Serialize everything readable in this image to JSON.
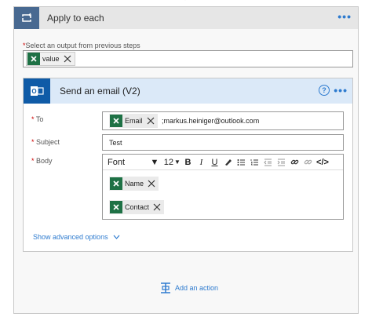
{
  "loop": {
    "title": "Apply to each",
    "more": "•••"
  },
  "select_output": {
    "label": "Select an output from previous steps",
    "required_mark": "*",
    "token": "value"
  },
  "action": {
    "title": "Send an email (V2)",
    "help": "?",
    "more": "•••",
    "to": {
      "label": "To",
      "token": "Email",
      "text": ";markus.heiniger@outlook.com"
    },
    "subject": {
      "label": "Subject",
      "value": "Test"
    },
    "body": {
      "label": "Body",
      "font": "Font",
      "font_size": "12",
      "tokens": [
        "Name",
        "Contact"
      ]
    },
    "advanced": "Show advanced options"
  },
  "add_action": "Add an action",
  "colors": {
    "accent": "#2e7bcf",
    "loop": "#486991",
    "outlook": "#0f5ba7",
    "excel": "#1e7145",
    "header_bg": "#dbe9f8"
  }
}
